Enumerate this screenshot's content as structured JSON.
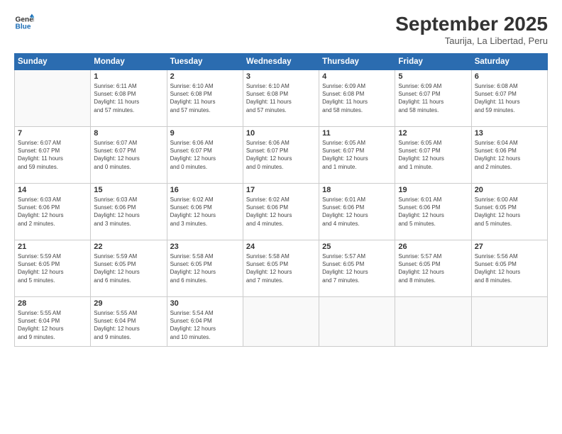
{
  "header": {
    "logo_line1": "General",
    "logo_line2": "Blue",
    "month": "September 2025",
    "location": "Taurija, La Libertad, Peru"
  },
  "days_of_week": [
    "Sunday",
    "Monday",
    "Tuesday",
    "Wednesday",
    "Thursday",
    "Friday",
    "Saturday"
  ],
  "weeks": [
    [
      {
        "day": "",
        "info": ""
      },
      {
        "day": "1",
        "info": "Sunrise: 6:11 AM\nSunset: 6:08 PM\nDaylight: 11 hours\nand 57 minutes."
      },
      {
        "day": "2",
        "info": "Sunrise: 6:10 AM\nSunset: 6:08 PM\nDaylight: 11 hours\nand 57 minutes."
      },
      {
        "day": "3",
        "info": "Sunrise: 6:10 AM\nSunset: 6:08 PM\nDaylight: 11 hours\nand 57 minutes."
      },
      {
        "day": "4",
        "info": "Sunrise: 6:09 AM\nSunset: 6:08 PM\nDaylight: 11 hours\nand 58 minutes."
      },
      {
        "day": "5",
        "info": "Sunrise: 6:09 AM\nSunset: 6:07 PM\nDaylight: 11 hours\nand 58 minutes."
      },
      {
        "day": "6",
        "info": "Sunrise: 6:08 AM\nSunset: 6:07 PM\nDaylight: 11 hours\nand 59 minutes."
      }
    ],
    [
      {
        "day": "7",
        "info": "Sunrise: 6:07 AM\nSunset: 6:07 PM\nDaylight: 11 hours\nand 59 minutes."
      },
      {
        "day": "8",
        "info": "Sunrise: 6:07 AM\nSunset: 6:07 PM\nDaylight: 12 hours\nand 0 minutes."
      },
      {
        "day": "9",
        "info": "Sunrise: 6:06 AM\nSunset: 6:07 PM\nDaylight: 12 hours\nand 0 minutes."
      },
      {
        "day": "10",
        "info": "Sunrise: 6:06 AM\nSunset: 6:07 PM\nDaylight: 12 hours\nand 0 minutes."
      },
      {
        "day": "11",
        "info": "Sunrise: 6:05 AM\nSunset: 6:07 PM\nDaylight: 12 hours\nand 1 minute."
      },
      {
        "day": "12",
        "info": "Sunrise: 6:05 AM\nSunset: 6:07 PM\nDaylight: 12 hours\nand 1 minute."
      },
      {
        "day": "13",
        "info": "Sunrise: 6:04 AM\nSunset: 6:06 PM\nDaylight: 12 hours\nand 2 minutes."
      }
    ],
    [
      {
        "day": "14",
        "info": "Sunrise: 6:03 AM\nSunset: 6:06 PM\nDaylight: 12 hours\nand 2 minutes."
      },
      {
        "day": "15",
        "info": "Sunrise: 6:03 AM\nSunset: 6:06 PM\nDaylight: 12 hours\nand 3 minutes."
      },
      {
        "day": "16",
        "info": "Sunrise: 6:02 AM\nSunset: 6:06 PM\nDaylight: 12 hours\nand 3 minutes."
      },
      {
        "day": "17",
        "info": "Sunrise: 6:02 AM\nSunset: 6:06 PM\nDaylight: 12 hours\nand 4 minutes."
      },
      {
        "day": "18",
        "info": "Sunrise: 6:01 AM\nSunset: 6:06 PM\nDaylight: 12 hours\nand 4 minutes."
      },
      {
        "day": "19",
        "info": "Sunrise: 6:01 AM\nSunset: 6:06 PM\nDaylight: 12 hours\nand 5 minutes."
      },
      {
        "day": "20",
        "info": "Sunrise: 6:00 AM\nSunset: 6:05 PM\nDaylight: 12 hours\nand 5 minutes."
      }
    ],
    [
      {
        "day": "21",
        "info": "Sunrise: 5:59 AM\nSunset: 6:05 PM\nDaylight: 12 hours\nand 5 minutes."
      },
      {
        "day": "22",
        "info": "Sunrise: 5:59 AM\nSunset: 6:05 PM\nDaylight: 12 hours\nand 6 minutes."
      },
      {
        "day": "23",
        "info": "Sunrise: 5:58 AM\nSunset: 6:05 PM\nDaylight: 12 hours\nand 6 minutes."
      },
      {
        "day": "24",
        "info": "Sunrise: 5:58 AM\nSunset: 6:05 PM\nDaylight: 12 hours\nand 7 minutes."
      },
      {
        "day": "25",
        "info": "Sunrise: 5:57 AM\nSunset: 6:05 PM\nDaylight: 12 hours\nand 7 minutes."
      },
      {
        "day": "26",
        "info": "Sunrise: 5:57 AM\nSunset: 6:05 PM\nDaylight: 12 hours\nand 8 minutes."
      },
      {
        "day": "27",
        "info": "Sunrise: 5:56 AM\nSunset: 6:05 PM\nDaylight: 12 hours\nand 8 minutes."
      }
    ],
    [
      {
        "day": "28",
        "info": "Sunrise: 5:55 AM\nSunset: 6:04 PM\nDaylight: 12 hours\nand 9 minutes."
      },
      {
        "day": "29",
        "info": "Sunrise: 5:55 AM\nSunset: 6:04 PM\nDaylight: 12 hours\nand 9 minutes."
      },
      {
        "day": "30",
        "info": "Sunrise: 5:54 AM\nSunset: 6:04 PM\nDaylight: 12 hours\nand 10 minutes."
      },
      {
        "day": "",
        "info": ""
      },
      {
        "day": "",
        "info": ""
      },
      {
        "day": "",
        "info": ""
      },
      {
        "day": "",
        "info": ""
      }
    ]
  ]
}
